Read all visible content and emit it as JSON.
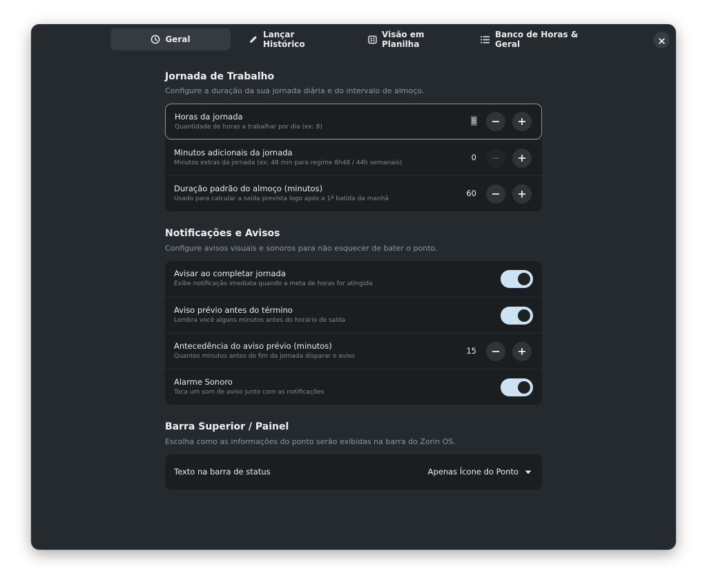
{
  "tabs": [
    {
      "label": "Geral",
      "icon": "clock-icon",
      "active": true
    },
    {
      "label": "Lançar Histórico",
      "icon": "pencil-icon"
    },
    {
      "label": "Visão em Planilha",
      "icon": "spreadsheet-icon"
    },
    {
      "label": "Banco de Horas & Geral",
      "icon": "list-icon"
    }
  ],
  "jornada": {
    "title": "Jornada de Trabalho",
    "desc": "Configure a duração da sua jornada diária e do intervalo de almoço.",
    "rows": [
      {
        "title": "Horas da jornada",
        "sub": "Quantidade de horas a trabalhar por dia (ex: 8)",
        "value": "8"
      },
      {
        "title": "Minutos adicionais da jornada",
        "sub": "Minutos extras da jornada (ex: 48 min para regime 8h48 / 44h semanais)",
        "value": "0"
      },
      {
        "title": "Duração padrão do almoço (minutos)",
        "sub": "Usado para calcular a saída prevista logo após a 1ª batida da manhã",
        "value": "60"
      }
    ]
  },
  "notificacoes": {
    "title": "Notificações e Avisos",
    "desc": "Configure avisos visuais e sonoros para não esquecer de bater o ponto.",
    "rows": [
      {
        "title": "Avisar ao completar jornada",
        "sub": "Exibe notificação imediata quando a meta de horas for atingida",
        "on": true
      },
      {
        "title": "Aviso prévio antes do término",
        "sub": "Lembra você alguns minutos antes do horário de saída",
        "on": true
      },
      {
        "title": "Antecedência do aviso prévio (minutos)",
        "sub": "Quantos minutos antes do fim da jornada disparar o aviso",
        "value": "15"
      },
      {
        "title": "Alarme Sonoro",
        "sub": "Toca um som de aviso junto com as notificações",
        "on": true
      }
    ]
  },
  "barra": {
    "title": "Barra Superior / Painel",
    "desc": "Escolha como as informações do ponto serão exibidas na barra do Zorin OS.",
    "row": {
      "title": "Texto na barra de status",
      "selected": "Apenas Ícone do Ponto"
    }
  },
  "colors": {
    "window_bg": "#252a2e",
    "card_bg": "#1a1e21",
    "switch_on": "#cde3f3"
  }
}
